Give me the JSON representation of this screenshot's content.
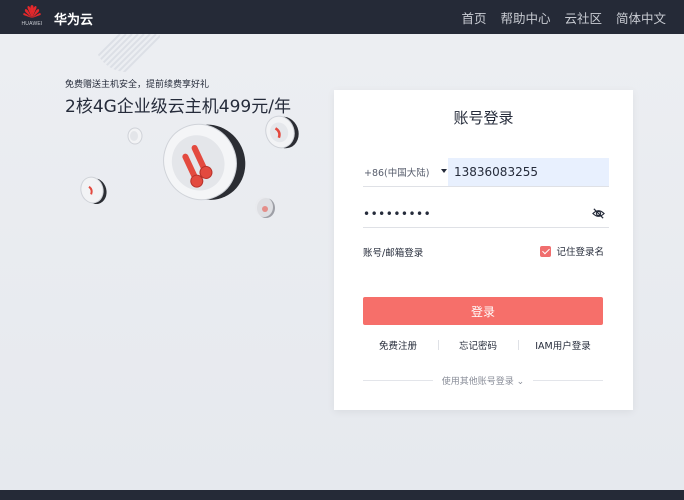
{
  "header": {
    "logo_word": "HUAWEI",
    "brand": "华为云",
    "nav": [
      "首页",
      "帮助中心",
      "云社区",
      "简体中文"
    ]
  },
  "hero": {
    "subtitle": "免费赠送主机安全，提前续费享好礼",
    "title": "2核4G企业级云主机499元/年"
  },
  "login": {
    "title": "账号登录",
    "country_code": "+86(中国大陆)",
    "phone_value": "13836083255",
    "password_value": "•••••••••",
    "account_email_link": "账号/邮箱登录",
    "remember_label": "记住登录名",
    "remember_checked": true,
    "login_button": "登录",
    "links": [
      "免费注册",
      "忘记密码",
      "IAM用户登录"
    ],
    "other_login": "使用其他账号登录 ⌄"
  },
  "colors": {
    "topbar": "#252a37",
    "accent": "#f66f6a",
    "input_autofill": "#e8f0fe"
  }
}
